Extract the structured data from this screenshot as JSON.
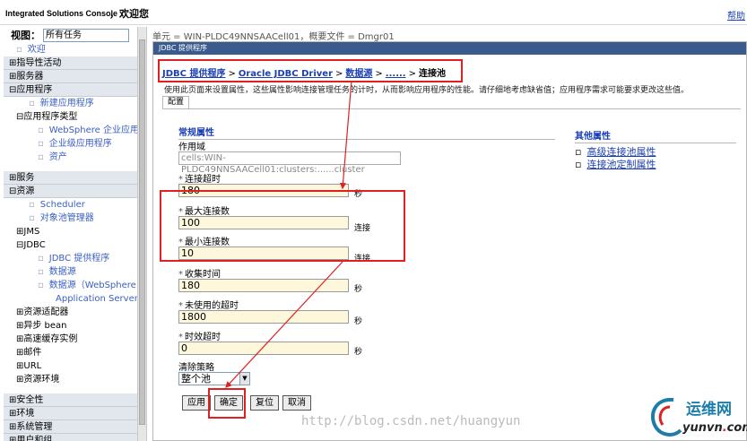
{
  "top": {
    "brand": "Integrated Solutions Console",
    "welcome": "，欢迎您",
    "help": "帮助"
  },
  "nav": {
    "view_label": "视图：",
    "view_value": "所有任务",
    "items": [
      {
        "label": "欢迎",
        "kind": "link",
        "level": 2,
        "bullet": "▫"
      },
      {
        "label": "⊞指导性活动",
        "kind": "header",
        "level": 1
      },
      {
        "label": "⊞服务器",
        "kind": "header",
        "level": 1
      },
      {
        "label": "⊟应用程序",
        "kind": "header",
        "level": 1
      },
      {
        "label": "新建应用程序",
        "kind": "link",
        "level": 3,
        "bullet": "▫"
      },
      {
        "label": "⊟应用程序类型",
        "kind": "plain",
        "level": 2
      },
      {
        "label": "WebSphere 企业应用",
        "kind": "link",
        "level": 4,
        "bullet": "▫"
      },
      {
        "label": "企业级应用程序",
        "kind": "link",
        "level": 4,
        "bullet": "▫"
      },
      {
        "label": "资产",
        "kind": "link",
        "level": 4,
        "bullet": "▫"
      },
      {
        "label": "",
        "kind": "spacer",
        "level": 1
      },
      {
        "label": "⊞服务",
        "kind": "header",
        "level": 1
      },
      {
        "label": "⊟资源",
        "kind": "header",
        "level": 1
      },
      {
        "label": "Scheduler",
        "kind": "link",
        "level": 3,
        "bullet": "▫"
      },
      {
        "label": "对象池管理器",
        "kind": "link",
        "level": 3,
        "bullet": "▫"
      },
      {
        "label": "⊞JMS",
        "kind": "plain",
        "level": 2
      },
      {
        "label": "⊟JDBC",
        "kind": "plain",
        "level": 2
      },
      {
        "label": "JDBC 提供程序",
        "kind": "link",
        "level": 4,
        "bullet": "▫"
      },
      {
        "label": "数据源",
        "kind": "link",
        "level": 4,
        "bullet": "▫"
      },
      {
        "label": "数据源（WebSphere",
        "kind": "link",
        "level": 4,
        "bullet": "▫"
      },
      {
        "label": "Application Server V",
        "kind": "link",
        "level": 5
      },
      {
        "label": "⊞资源适配器",
        "kind": "plain",
        "level": 2
      },
      {
        "label": "⊞异步 bean",
        "kind": "plain",
        "level": 2
      },
      {
        "label": "⊞高速缓存实例",
        "kind": "plain",
        "level": 2
      },
      {
        "label": "⊞邮件",
        "kind": "plain",
        "level": 2
      },
      {
        "label": "⊞URL",
        "kind": "plain",
        "level": 2
      },
      {
        "label": "⊞资源环境",
        "kind": "plain",
        "level": 2
      },
      {
        "label": "",
        "kind": "spacer",
        "level": 1
      },
      {
        "label": "⊞安全性",
        "kind": "header",
        "level": 1
      },
      {
        "label": "⊞环境",
        "kind": "header",
        "level": 1
      },
      {
        "label": "⊞系统管理",
        "kind": "header",
        "level": 1
      },
      {
        "label": "⊞用户和组",
        "kind": "header",
        "level": 1
      }
    ]
  },
  "main": {
    "cellinfo": "单元 = WIN-PLDC49NNSAACell01，概要文件 = Dmgr01",
    "panel_title": "JDBC 提供程序",
    "breadcrumb": {
      "b1": "JDBC 提供程序",
      "b2": "Oracle JDBC Driver",
      "b3": "数据源",
      "b4": "......",
      "current": "连接池",
      "sep": ">"
    },
    "description": "使用此页面来设置属性，这些属性影响连接管理任务的计时，从而影响应用程序的性能。请仔细地考虑缺省值；应用程序需求可能要求更改这些值。",
    "tab": "配置",
    "general_title": "常规属性",
    "scope_label": "作用域",
    "scope_value": "cells:WIN-PLDC49NNSAACell01:clusters:......cluster",
    "fields": {
      "connection_timeout": {
        "label": "连接超时",
        "value": "180",
        "unit": "秒"
      },
      "max_connections": {
        "label": "最大连接数",
        "value": "100",
        "unit": "连接"
      },
      "min_connections": {
        "label": "最小连接数",
        "value": "10",
        "unit": "连接"
      },
      "reap_time": {
        "label": "收集时间",
        "value": "180",
        "unit": "秒"
      },
      "unused_timeout": {
        "label": "未使用的超时",
        "value": "1800",
        "unit": "秒"
      },
      "aged_timeout": {
        "label": "时效超时",
        "value": "0",
        "unit": "秒"
      }
    },
    "purge_label": "清除策略",
    "purge_value": "整个池",
    "req_mark": "*",
    "other_title": "其他属性",
    "other_links": [
      "高级连接池属性",
      "连接池定制属性"
    ],
    "buttons": {
      "apply": "应用",
      "ok": "确定",
      "reset": "复位",
      "cancel": "取消"
    }
  },
  "overlay": {
    "watermark": "http://blog.csdn.net/huangyun",
    "logo_cn": "运维网",
    "logo_en_a": "yunvn",
    "logo_en_dot": ".",
    "logo_en_b": "com",
    "accent": "#e02020"
  }
}
